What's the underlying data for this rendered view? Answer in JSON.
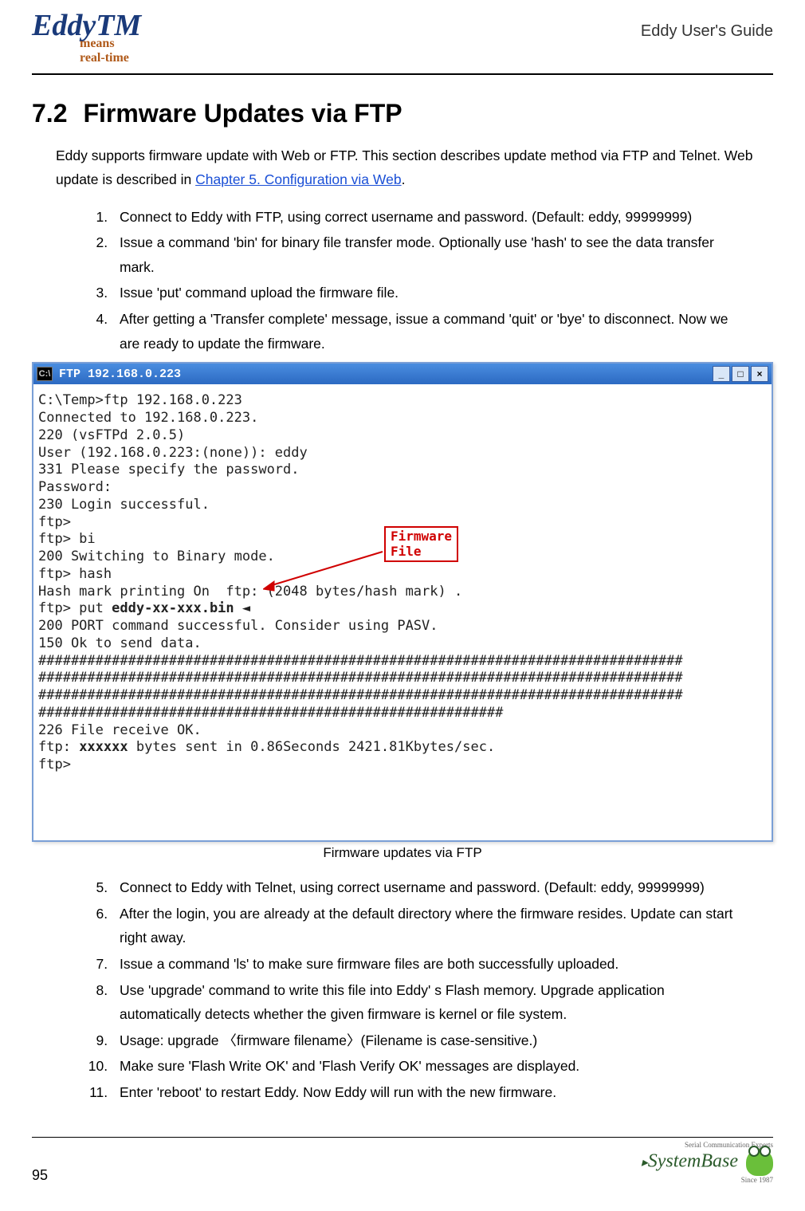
{
  "header": {
    "logo_main": "Eddy",
    "logo_tm": "TM",
    "logo_sub1": "means",
    "logo_sub2": "real-time",
    "guide_title": "Eddy User's Guide"
  },
  "section": {
    "number": "7.2",
    "title": "Firmware Updates via FTP"
  },
  "intro": {
    "text1": "Eddy supports firmware update with Web or FTP. This section describes update method via FTP and Telnet. Web update is described in ",
    "link_text": "Chapter 5. Configuration via Web",
    "text2": "."
  },
  "steps_a": [
    "Connect to Eddy with FTP, using correct username and password. (Default: eddy, 99999999)",
    "Issue a command  'bin'  for binary file transfer mode. Optionally use  'hash'  to see the data transfer mark.",
    "Issue  'put'  command upload the firmware file.",
    "After getting a  'Transfer complete'  message, issue a command  'quit'  or  'bye'  to disconnect. Now we are ready to update the firmware."
  ],
  "terminal": {
    "title_icon": "C:\\",
    "title": "FTP   192.168.0.223",
    "callout": "Firmware\nFile",
    "lines_pre": "C:\\Temp>ftp 192.168.0.223\nConnected to 192.168.0.223.\n220 (vsFTPd 2.0.5)\nUser (192.168.0.223:(none)): eddy\n331 Please specify the password.\nPassword:\n230 Login successful.\nftp>\nftp> bi\n200 Switching to Binary mode.\nftp> hash\nHash mark printing On  ftp: (2048 bytes/hash mark) .\nftp> put ",
    "fw_name": "eddy-xx-xxx.bin",
    "lines_mid": "\n200 PORT command successful. Consider using PASV.\n150 Ok to send data.\n###############################################################################\n###############################################################################\n###############################################################################\n#########################################################\n226 File receive OK.\nftp: ",
    "bytes": "xxxxxx",
    "lines_post": " bytes sent in 0.86Seconds 2421.81Kbytes/sec.\nftp>"
  },
  "figure_caption": "Firmware updates via FTP",
  "steps_b": [
    "Connect to Eddy with Telnet, using correct username and password. (Default: eddy, 99999999)",
    "After the login, you are already at the default directory where the firmware resides. Update can start right away.",
    "Issue a command  'ls'  to make sure firmware files are both successfully uploaded.",
    "Use  'upgrade'  command to write this file into Eddy' s Flash memory. Upgrade application automatically detects whether the given firmware is kernel or file system.",
    "Usage: upgrade 〈firmware filename〉(Filename is case-sensitive.)",
    "Make sure  'Flash Write OK'  and  'Flash Verify OK'  messages are displayed.",
    "Enter  'reboot'  to restart Eddy. Now Eddy will run with the new firmware."
  ],
  "footer": {
    "page_number": "95",
    "sb_tag": "Serial Communication Experts",
    "sb_name": "SystemBase",
    "sb_since": "Since 1987"
  }
}
